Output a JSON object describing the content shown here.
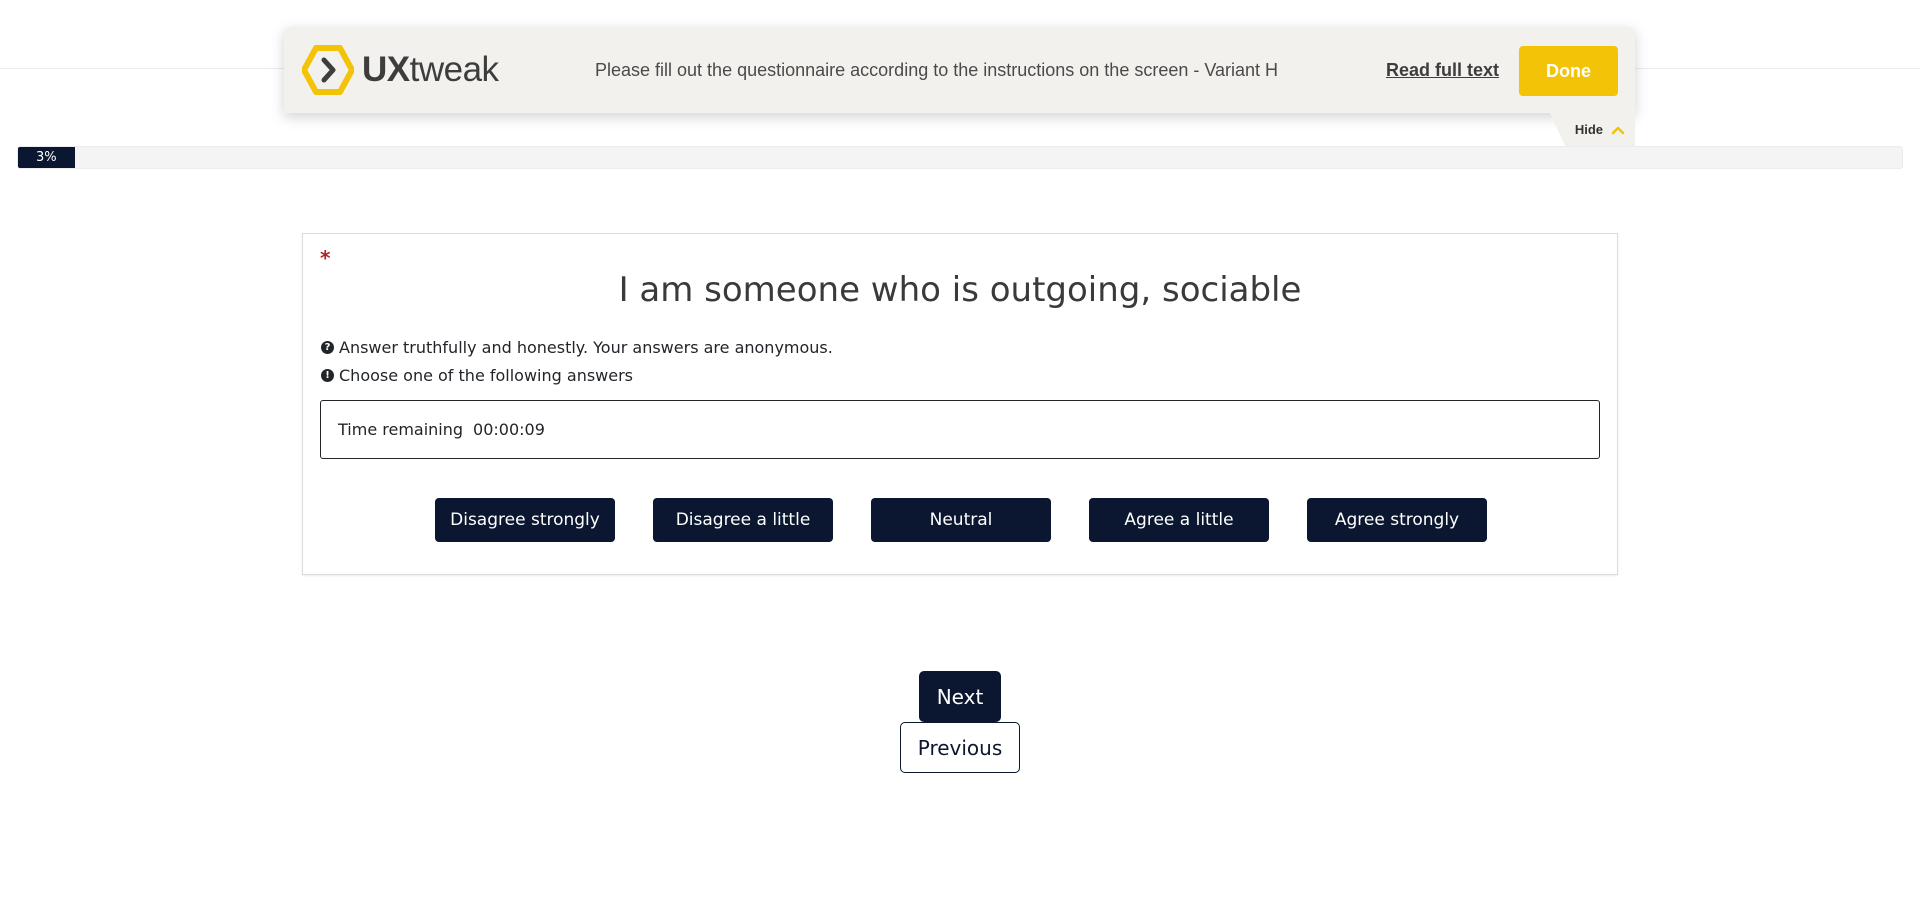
{
  "banner": {
    "logo_text_bold": "UX",
    "logo_text_regular": "tweak",
    "instruction": "Please fill out the questionnaire according to the instructions on the screen - Variant H",
    "read_full_label": "Read full text",
    "done_label": "Done",
    "hide_label": "Hide"
  },
  "progress": {
    "percent": 3,
    "label": "3%"
  },
  "question": {
    "required_mark": "*",
    "title": "I am someone who is outgoing, sociable",
    "hint_help": "Answer truthfully and honestly. Your answers are anonymous.",
    "hint_instruction": "Choose one of the following answers",
    "timer_label": "Time remaining",
    "timer_value": "00:00:09",
    "answers": [
      {
        "label": "Disagree strongly"
      },
      {
        "label": "Disagree a little"
      },
      {
        "label": "Neutral"
      },
      {
        "label": "Agree a little"
      },
      {
        "label": "Agree strongly"
      }
    ]
  },
  "navigation": {
    "next_label": "Next",
    "previous_label": "Previous"
  },
  "colors": {
    "brand_yellow": "#f2c307",
    "dark_navy": "#0b1730",
    "banner_bg": "#f2f1ed"
  },
  "icons": {
    "logo": "uxtweak-hexagon-logo",
    "hide_chevron": "chevron-up-icon",
    "help": "question-circle-icon",
    "info": "exclamation-circle-icon"
  }
}
